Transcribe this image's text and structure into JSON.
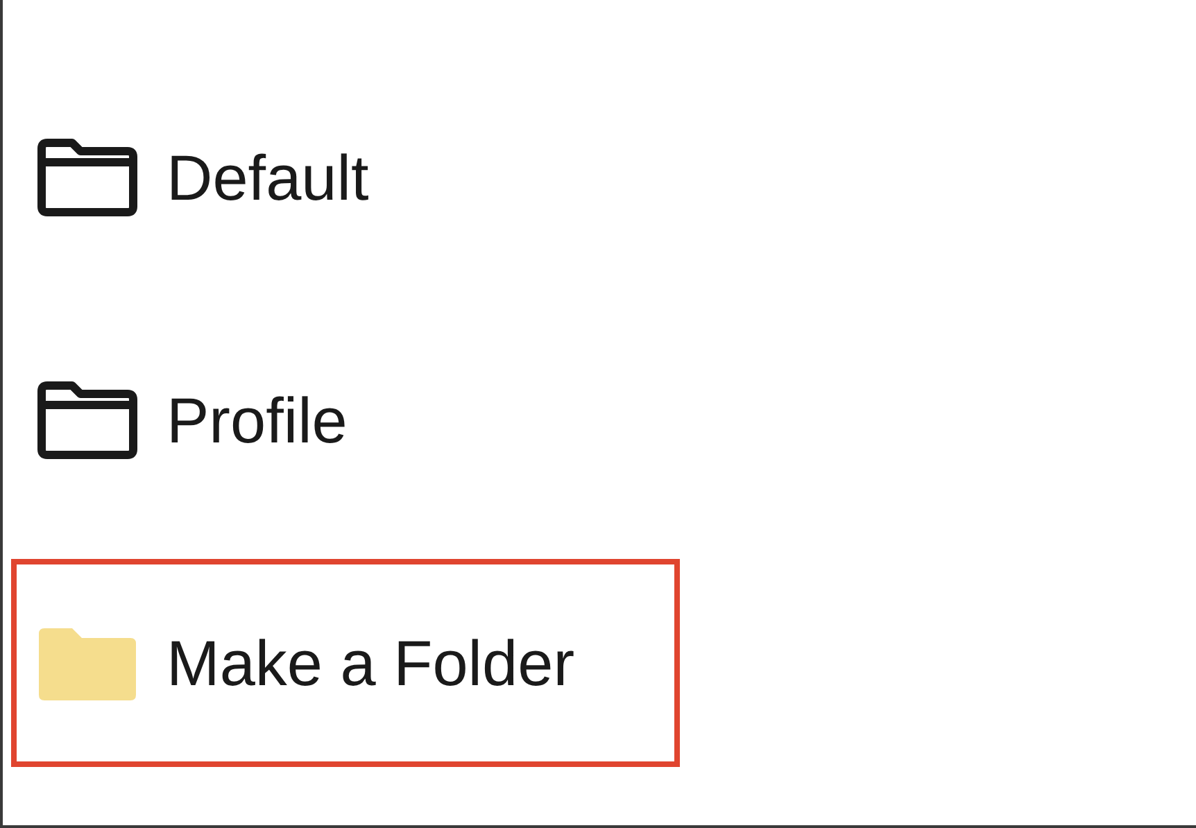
{
  "folders": [
    {
      "label": "Default",
      "kind": "folder",
      "highlighted": false
    },
    {
      "label": "Profile",
      "kind": "folder",
      "highlighted": false
    },
    {
      "label": "Make a Folder",
      "kind": "new-folder",
      "highlighted": true
    }
  ]
}
